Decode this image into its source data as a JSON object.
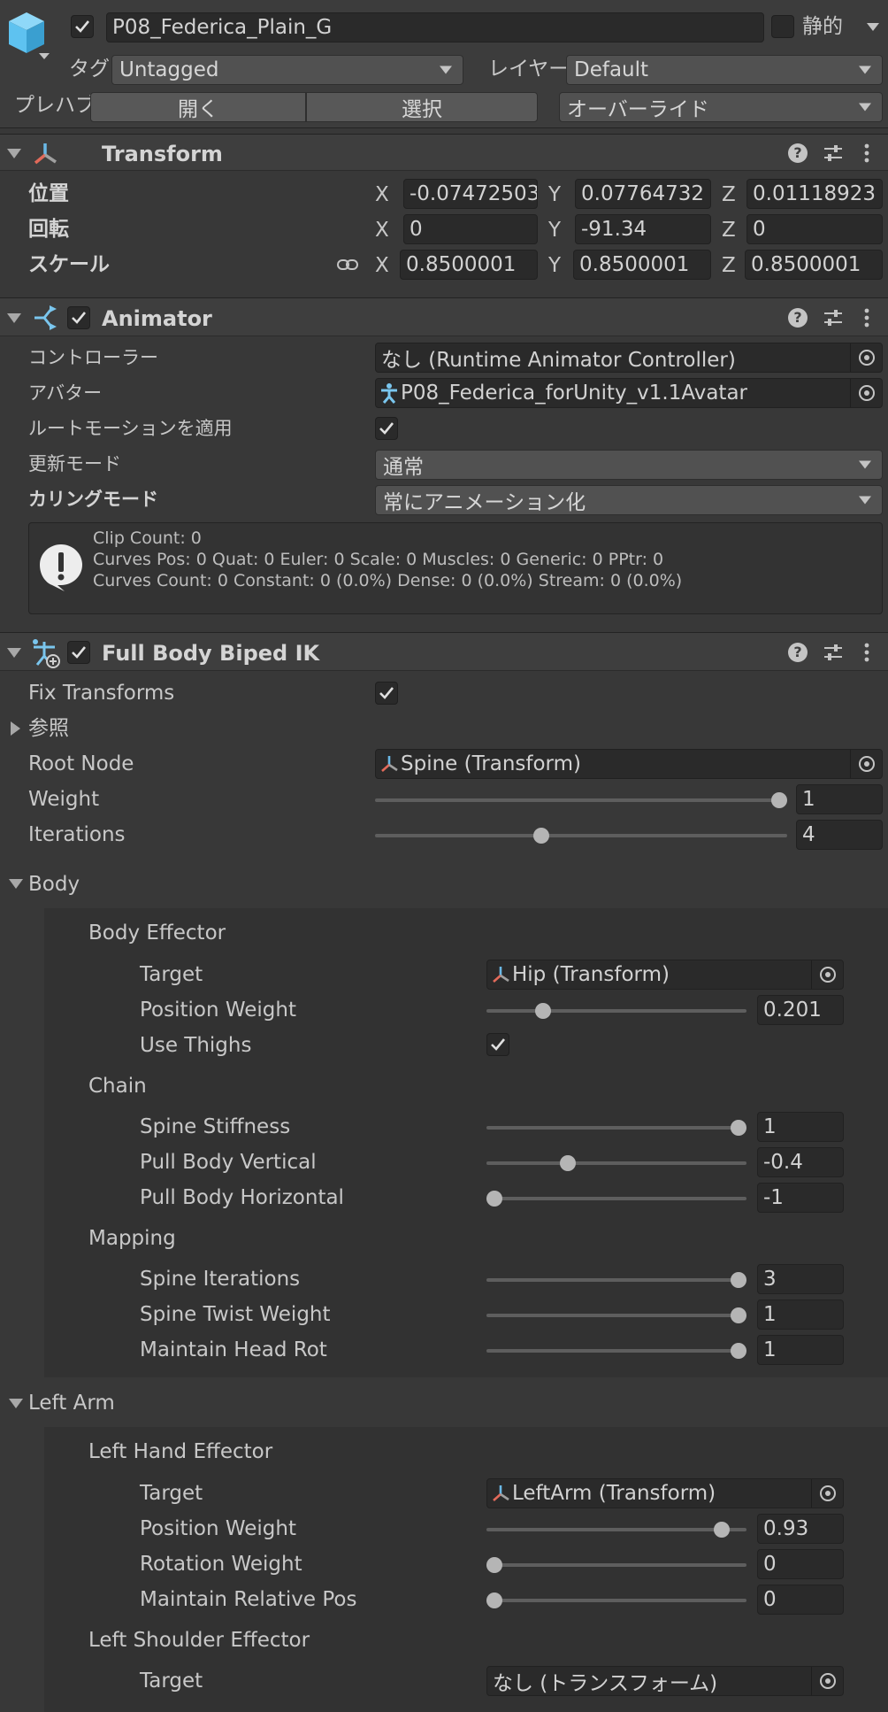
{
  "header": {
    "object_name": "P08_Federica_Plain_G",
    "static_label": "静的",
    "tag_label": "タグ",
    "tag_value": "Untagged",
    "layer_label": "レイヤー",
    "layer_value": "Default",
    "prefab_label": "プレハブ",
    "open_label": "開く",
    "select_label": "選択",
    "override_label": "オーバーライド"
  },
  "transform": {
    "title": "Transform",
    "position_label": "位置",
    "rotation_label": "回転",
    "scale_label": "スケール",
    "axis_x": "X",
    "axis_y": "Y",
    "axis_z": "Z",
    "position": {
      "x": "-0.07472503",
      "y": "0.07764732",
      "z": "0.01118923"
    },
    "rotation": {
      "x": "0",
      "y": "-91.34",
      "z": "0"
    },
    "scale": {
      "x": "0.8500001",
      "y": "0.8500001",
      "z": "0.8500001"
    }
  },
  "animator": {
    "title": "Animator",
    "controller_label": "コントローラー",
    "controller_value": "なし (Runtime Animator Controller)",
    "avatar_label": "アバター",
    "avatar_value": "P08_Federica_forUnity_v1.1Avatar",
    "root_motion_label": "ルートモーションを適用",
    "update_mode_label": "更新モード",
    "update_mode_value": "通常",
    "culling_mode_label": "カリングモード",
    "culling_mode_value": "常にアニメーション化",
    "info_lines": [
      "Clip Count: 0",
      "Curves Pos: 0 Quat: 0 Euler: 0 Scale: 0 Muscles: 0 Generic: 0 PPtr: 0",
      "Curves Count: 0 Constant: 0 (0.0%) Dense: 0 (0.0%) Stream: 0 (0.0%)"
    ]
  },
  "ik": {
    "title": "Full Body Biped IK",
    "fix_transforms_label": "Fix Transforms",
    "references_label": "参照",
    "root_node_label": "Root Node",
    "root_node_value": "Spine (Transform)",
    "weight_label": "Weight",
    "weight_value": "1",
    "weight_fraction": 1.0,
    "iterations_label": "Iterations",
    "iterations_value": "4",
    "iterations_fraction": 0.4
  },
  "body": {
    "title": "Body",
    "effector_title": "Body Effector",
    "target_label": "Target",
    "target_value": "Hip (Transform)",
    "position_weight_label": "Position Weight",
    "position_weight_value": "0.201",
    "position_weight_fraction": 0.201,
    "use_thighs_label": "Use Thighs",
    "chain_title": "Chain",
    "spine_stiffness_label": "Spine Stiffness",
    "spine_stiffness_value": "1",
    "spine_stiffness_fraction": 1.0,
    "pull_vertical_label": "Pull Body Vertical",
    "pull_vertical_value": "-0.4",
    "pull_vertical_fraction": 0.3,
    "pull_horizontal_label": "Pull Body Horizontal",
    "pull_horizontal_value": "-1",
    "pull_horizontal_fraction": 0.0,
    "mapping_title": "Mapping",
    "spine_iterations_label": "Spine Iterations",
    "spine_iterations_value": "3",
    "spine_iterations_fraction": 1.0,
    "spine_twist_label": "Spine Twist Weight",
    "spine_twist_value": "1",
    "spine_twist_fraction": 1.0,
    "maintain_head_label": "Maintain Head Rot",
    "maintain_head_value": "1",
    "maintain_head_fraction": 1.0
  },
  "left_arm": {
    "title": "Left Arm",
    "hand_effector_title": "Left Hand Effector",
    "target_label": "Target",
    "target_value": "LeftArm (Transform)",
    "position_weight_label": "Position Weight",
    "position_weight_value": "0.93",
    "position_weight_fraction": 0.93,
    "rotation_weight_label": "Rotation Weight",
    "rotation_weight_value": "0",
    "rotation_weight_fraction": 0.0,
    "maintain_relative_label": "Maintain Relative Pos",
    "maintain_relative_value": "0",
    "maintain_relative_fraction": 0.0,
    "shoulder_effector_title": "Left Shoulder Effector",
    "shoulder_target_label": "Target",
    "shoulder_target_value": "なし (トランスフォーム)"
  },
  "colors": {
    "background": "#383838",
    "field": "#2a2a2a",
    "accent_cube": "#5ec2f0",
    "transform_red": "#e26a5a",
    "transform_blue": "#6ab8e6"
  }
}
